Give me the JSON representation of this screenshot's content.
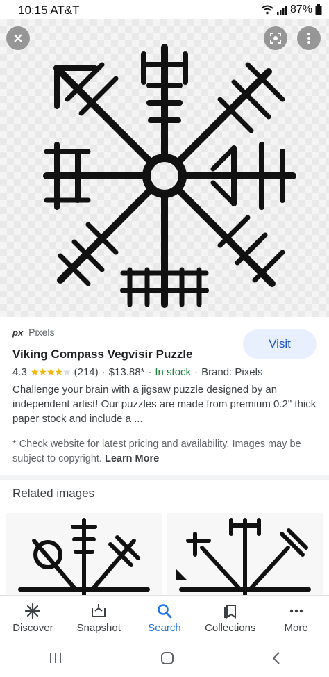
{
  "status": {
    "time": "10:15 AT&T",
    "battery": "87%"
  },
  "result": {
    "source_logo": "px",
    "source_name": "Pixels",
    "title": "Viking Compass Vegvisir Puzzle",
    "rating": "4.3",
    "stars_filled": 4.3,
    "reviews": "(214)",
    "price": "$13.88*",
    "stock": "In stock",
    "brand": "Brand: Pixels",
    "visit_label": "Visit",
    "description": "Challenge your brain with a jigsaw puzzle designed by an independent artist! Our puzzles are made from premium 0.2\" thick paper stock and include a ...",
    "note_text": "* Check website for latest pricing and availability. Images may be subject to copyright.",
    "note_link": "Learn More"
  },
  "related": {
    "heading": "Related images"
  },
  "bottom_nav": [
    {
      "label": "Discover",
      "icon": "asterisk-icon"
    },
    {
      "label": "Snapshot",
      "icon": "snapshot-icon"
    },
    {
      "label": "Search",
      "icon": "search-icon"
    },
    {
      "label": "Collections",
      "icon": "collections-icon"
    },
    {
      "label": "More",
      "icon": "more-dots-icon"
    }
  ],
  "colors": {
    "accent": "#1a73e8",
    "stock": "#188038",
    "star": "#f4b400",
    "visit_bg": "#e8f0fe"
  }
}
